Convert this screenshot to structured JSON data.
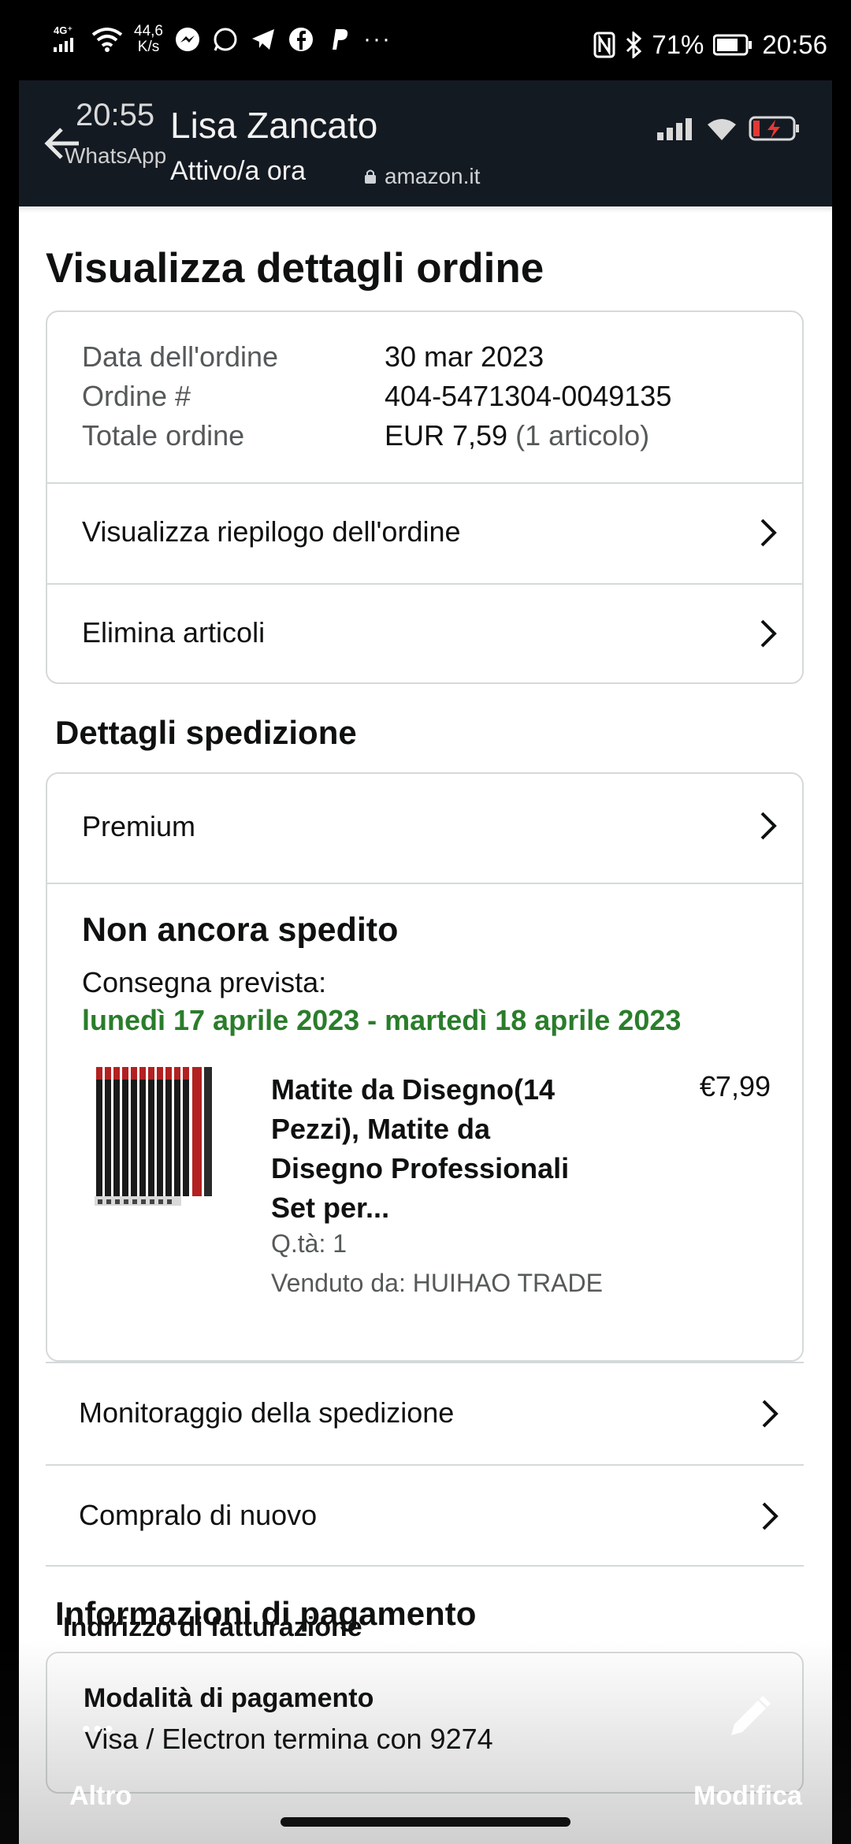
{
  "status_bar": {
    "network": "4G⁺ ⁴ᴳ",
    "speed": "44,6\nK/s",
    "speed_value": "44,6",
    "speed_unit": "K/s",
    "battery": "71%",
    "time": "20:56"
  },
  "overlay_header": {
    "time": "20:55",
    "app": "WhatsApp",
    "contact_name": "Lisa Zancato",
    "contact_status": "Attivo/a ora",
    "url": "amazon.it"
  },
  "page": {
    "title": "Visualizza dettagli ordine",
    "order_info": {
      "date_label": "Data dell'ordine",
      "date_value": "30 mar 2023",
      "number_label": "Ordine #",
      "number_value": "404-5471304-0049135",
      "total_label": "Totale ordine",
      "total_value": "EUR 7,59",
      "total_items": "(1 articolo)"
    },
    "order_links": {
      "summary": "Visualizza riepilogo dell'ordine",
      "delete_items": "Elimina articoli"
    },
    "shipping": {
      "section_title": "Dettagli spedizione",
      "method": "Premium",
      "status": "Non ancora spedito",
      "expected_label": "Consegna prevista:",
      "expected_range": "lunedì 17 aprile 2023 - martedì 18 aprile 2023",
      "product": {
        "title": "Matite da Disegno(14 Pezzi), Matite da Disegno Professionali Set per...",
        "price": "€7,99",
        "qty": "Q.tà: 1",
        "seller": "Venduto da: HUIHAO TRADE"
      },
      "track": "Monitoraggio della spedizione",
      "buy_again": "Compralo di nuovo"
    },
    "payment": {
      "section_title": "Informazioni di pagamento",
      "method_title": "Modalità di pagamento",
      "method_value": "Visa / Electron  termina con 9274",
      "billing_title": "Indirizzo di fatturazione"
    }
  },
  "bottom_overlay": {
    "more": "Altro",
    "edit": "Modifica"
  }
}
